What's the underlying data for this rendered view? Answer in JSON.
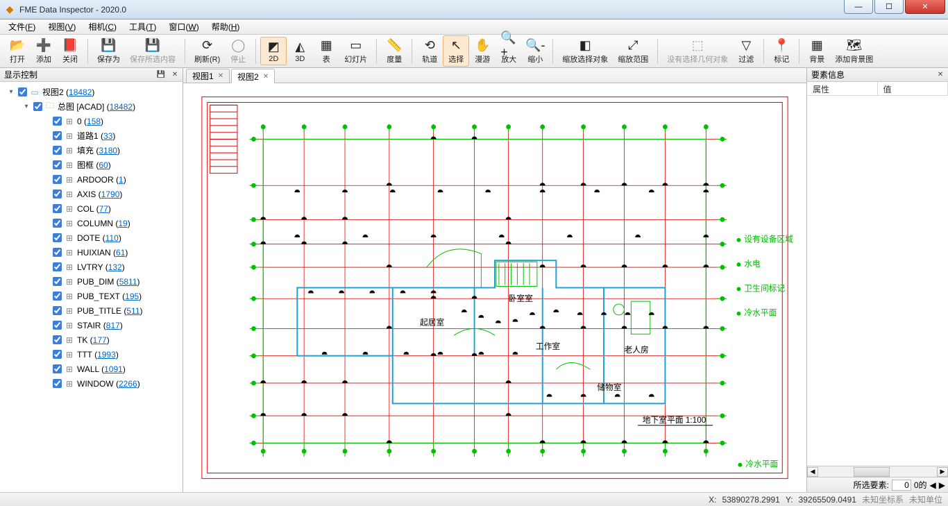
{
  "window": {
    "title": "FME Data Inspector - 2020.0"
  },
  "menus": [
    {
      "label": "文件",
      "accel": "F"
    },
    {
      "label": "视图",
      "accel": "V"
    },
    {
      "label": "相机",
      "accel": "C"
    },
    {
      "label": "工具",
      "accel": "T"
    },
    {
      "label": "窗口",
      "accel": "W"
    },
    {
      "label": "帮助",
      "accel": "H"
    }
  ],
  "toolbar": [
    {
      "name": "open-button",
      "label": "打开",
      "icon": "📂"
    },
    {
      "name": "add-button",
      "label": "添加",
      "icon": "➕"
    },
    {
      "name": "close-button",
      "label": "关闭",
      "icon": "📕"
    },
    {
      "sep": true
    },
    {
      "name": "saveas-button",
      "label": "保存为",
      "icon": "💾"
    },
    {
      "name": "save-selected-button",
      "label": "保存所选内容",
      "icon": "💾",
      "disabled": true
    },
    {
      "sep": true
    },
    {
      "name": "refresh-button",
      "label": "刷新(R)",
      "icon": "⟳"
    },
    {
      "name": "stop-button",
      "label": "停止",
      "icon": "◯",
      "disabled": true
    },
    {
      "sep": true
    },
    {
      "name": "2d-button",
      "label": "2D",
      "icon": "◩",
      "active": true
    },
    {
      "name": "3d-button",
      "label": "3D",
      "icon": "◭"
    },
    {
      "name": "table-button",
      "label": "表",
      "icon": "▦"
    },
    {
      "name": "slideshow-button",
      "label": "幻灯片",
      "icon": "▭"
    },
    {
      "sep": true
    },
    {
      "name": "measure-button",
      "label": "度量",
      "icon": "📏"
    },
    {
      "sep": true
    },
    {
      "name": "orbit-button",
      "label": "轨道",
      "icon": "⟲"
    },
    {
      "name": "select-button",
      "label": "选择",
      "icon": "↖",
      "active": true
    },
    {
      "name": "pan-button",
      "label": "漫游",
      "icon": "✋"
    },
    {
      "name": "zoomin-button",
      "label": "放大",
      "icon": "🔍+"
    },
    {
      "name": "zoomout-button",
      "label": "缩小",
      "icon": "🔍-"
    },
    {
      "sep": true
    },
    {
      "name": "zoom-selected-button",
      "label": "缩放选择对象",
      "icon": "◧"
    },
    {
      "name": "zoom-extents-button",
      "label": "缩放范围",
      "icon": "⤢"
    },
    {
      "sep": true
    },
    {
      "name": "no-selection-label",
      "label": "没有选择几何对象",
      "icon": "⬚",
      "disabled": true
    },
    {
      "name": "filter-button",
      "label": "过滤",
      "icon": "▽"
    },
    {
      "sep": true
    },
    {
      "name": "mark-button",
      "label": "标记",
      "icon": "📍"
    },
    {
      "sep": true
    },
    {
      "name": "background-button",
      "label": "背景",
      "icon": "▦"
    },
    {
      "name": "add-background-button",
      "label": "添加背景图",
      "icon": "🗺"
    }
  ],
  "left_panel": {
    "title": "显示控制",
    "root": {
      "label": "视图2",
      "count": "18482"
    },
    "dataset": {
      "label": "总图 [ACAD]",
      "count": "18482"
    },
    "layers": [
      {
        "label": "0",
        "count": "158"
      },
      {
        "label": "道路1",
        "count": "33"
      },
      {
        "label": "填充",
        "count": "3180"
      },
      {
        "label": "图框",
        "count": "60"
      },
      {
        "label": "ARDOOR",
        "count": "1"
      },
      {
        "label": "AXIS",
        "count": "1790"
      },
      {
        "label": "COL",
        "count": "77"
      },
      {
        "label": "COLUMN",
        "count": "19"
      },
      {
        "label": "DOTE",
        "count": "110"
      },
      {
        "label": "HUIXIAN",
        "count": "61"
      },
      {
        "label": "LVTRY",
        "count": "132"
      },
      {
        "label": "PUB_DIM",
        "count": "5811"
      },
      {
        "label": "PUB_TEXT",
        "count": "195"
      },
      {
        "label": "PUB_TITLE",
        "count": "511"
      },
      {
        "label": "STAIR",
        "count": "817"
      },
      {
        "label": "TK",
        "count": "177"
      },
      {
        "label": "TTT",
        "count": "1993"
      },
      {
        "label": "WALL",
        "count": "1091"
      },
      {
        "label": "WINDOW",
        "count": "2266"
      }
    ]
  },
  "tabs": [
    {
      "label": "视图1",
      "active": false
    },
    {
      "label": "视图2",
      "active": true
    }
  ],
  "right_panel": {
    "title": "要素信息",
    "col_attr": "属性",
    "col_value": "值",
    "sel_label": "所选要素:",
    "sel_value": "0",
    "sel_suffix": "0的"
  },
  "status": {
    "x_label": "X:",
    "x_value": "53890278.2991",
    "y_label": "Y:",
    "y_value": "39265509.0491",
    "coord_sys": "未知坐标系",
    "unit": "未知单位"
  },
  "drawing": {
    "frame_color": "#e00000",
    "axis_color": "#00c000",
    "wall_color": "#20a0d0",
    "title_text": "地下室平面 1:100",
    "room_labels": [
      "起居室",
      "卧室室",
      "工作室",
      "老人房",
      "储物室"
    ],
    "legend": [
      "设有设备区域",
      "水电",
      "卫生间标记",
      "冷水平面"
    ]
  }
}
